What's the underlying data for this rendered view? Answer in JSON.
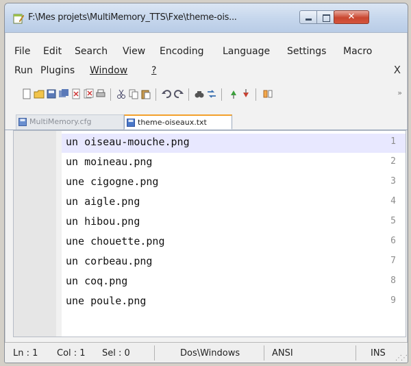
{
  "window": {
    "title": "F:\\Mes projets\\MultiMemory_TTS\\Fxe\\theme-ois..."
  },
  "menu": {
    "row1": [
      "File",
      "Edit",
      "Search",
      "View",
      "Encoding",
      "Language",
      "Settings",
      "Macro"
    ],
    "row2": [
      "Run",
      "Plugins",
      "Window",
      "?"
    ],
    "close": "X"
  },
  "toolbar": {
    "more": "»"
  },
  "tabs": [
    {
      "label": "MultiMemory.cfg"
    },
    {
      "label": "theme-oiseaux.txt"
    }
  ],
  "editor": {
    "lines": [
      {
        "num": "1",
        "text": "un oiseau-mouche.png"
      },
      {
        "num": "2",
        "text": "un moineau.png"
      },
      {
        "num": "3",
        "text": "une cigogne.png"
      },
      {
        "num": "4",
        "text": "un aigle.png"
      },
      {
        "num": "5",
        "text": "un hibou.png"
      },
      {
        "num": "6",
        "text": "une chouette.png"
      },
      {
        "num": "7",
        "text": "un corbeau.png"
      },
      {
        "num": "8",
        "text": "un coq.png"
      },
      {
        "num": "9",
        "text": "une poule.png"
      }
    ]
  },
  "status": {
    "ln": "Ln : 1",
    "col": "Col : 1",
    "sel": "Sel : 0",
    "eol": "Dos\\Windows",
    "encoding": "ANSI",
    "mode": "INS"
  },
  "colors": {
    "current_line": "#e8e8ff",
    "active_tab_accent": "#f3a02a",
    "close_button": "#c9462f"
  }
}
